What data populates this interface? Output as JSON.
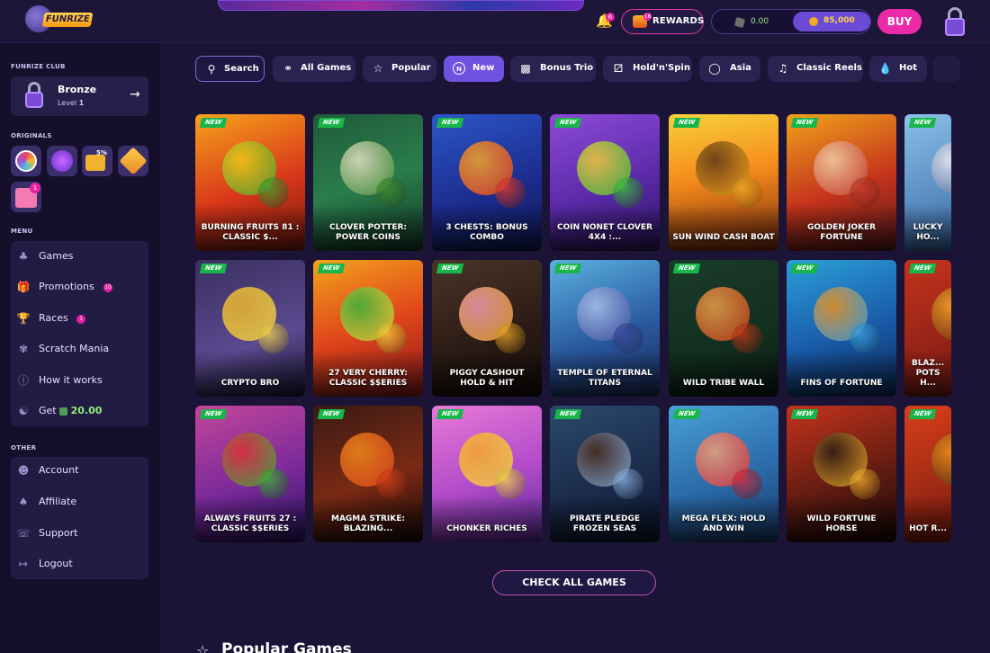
{
  "header": {
    "logo_text": "FUNRIZE",
    "notifications_count": "6",
    "rewards_label": "REWARDS",
    "rewards_badge": "18",
    "balance_sc": "0.00",
    "balance_gc": "85,000",
    "buy_label": "BUY"
  },
  "sidebar": {
    "club_label": "FUNRIZE CLUB",
    "club_tier": "Bronze",
    "club_level_prefix": "Level ",
    "club_level": "1",
    "originals_label": "ORIGINALS",
    "originals_badge": "5%",
    "originals_count": "1",
    "menu_label": "MENU",
    "menu": [
      {
        "label": "Games",
        "icon": "games-icon"
      },
      {
        "label": "Promotions",
        "icon": "gift-icon",
        "badge": "10"
      },
      {
        "label": "Races",
        "icon": "trophy-icon",
        "badge": "1"
      },
      {
        "label": "Scratch Mania",
        "icon": "scratch-icon"
      },
      {
        "label": "How it works",
        "icon": "info-icon"
      },
      {
        "label": "Get",
        "icon": "referral-icon",
        "value": "20.00"
      }
    ],
    "other_label": "OTHER",
    "other": [
      {
        "label": "Account",
        "icon": "account-icon"
      },
      {
        "label": "Affiliate",
        "icon": "affiliate-icon"
      },
      {
        "label": "Support",
        "icon": "support-icon"
      },
      {
        "label": "Logout",
        "icon": "logout-icon"
      }
    ]
  },
  "filters": [
    {
      "label": "Search",
      "icon": "search-icon"
    },
    {
      "label": "All Games",
      "icon": "cherries-icon"
    },
    {
      "label": "Popular",
      "icon": "star-icon"
    },
    {
      "label": "New",
      "icon": "new-icon",
      "active": true
    },
    {
      "label": "Bonus Trio",
      "icon": "bonus-icon"
    },
    {
      "label": "Hold'n'Spin",
      "icon": "dice-icon"
    },
    {
      "label": "Asia",
      "icon": "globe-icon"
    },
    {
      "label": "Classic Reels",
      "icon": "bell-icon"
    },
    {
      "label": "Hot",
      "icon": "fire-icon"
    }
  ],
  "games": {
    "badge_label": "NEW",
    "rows": [
      [
        "BURNING FRUITS 81 : CLASSIC $...",
        "CLOVER POTTER: POWER COINS",
        "3 CHESTS: BONUS COMBO",
        "COIN NONET CLOVER 4X4 :...",
        "SUN WIND CASH BOAT",
        "GOLDEN JOKER FORTUNE",
        "LUCKY HO..."
      ],
      [
        "CRYPTO BRO",
        "27 VERY CHERRY: CLASSIC $$ERIES",
        "PIGGY CASHOUT HOLD & HIT",
        "TEMPLE OF ETERNAL TITANS",
        "WILD TRIBE WALL",
        "FINS OF FORTUNE",
        "BLAZ... POTS H..."
      ],
      [
        "ALWAYS FRUITS 27 : CLASSIC $$ERIES",
        "MAGMA STRIKE: BLAZING...",
        "CHONKER RICHES",
        "PIRATE PLEDGE FROZEN SEAS",
        "MEGA FLEX: HOLD AND WIN",
        "WILD FORTUNE HORSE",
        "HOT R..."
      ]
    ]
  },
  "check_all_label": "CHECK ALL GAMES",
  "popular_heading": "Popular Games",
  "colors": {
    "accent": "#6f52e0",
    "pink": "#ec2aa8",
    "background": "#1b1436",
    "new_badge": "#18b64a"
  }
}
